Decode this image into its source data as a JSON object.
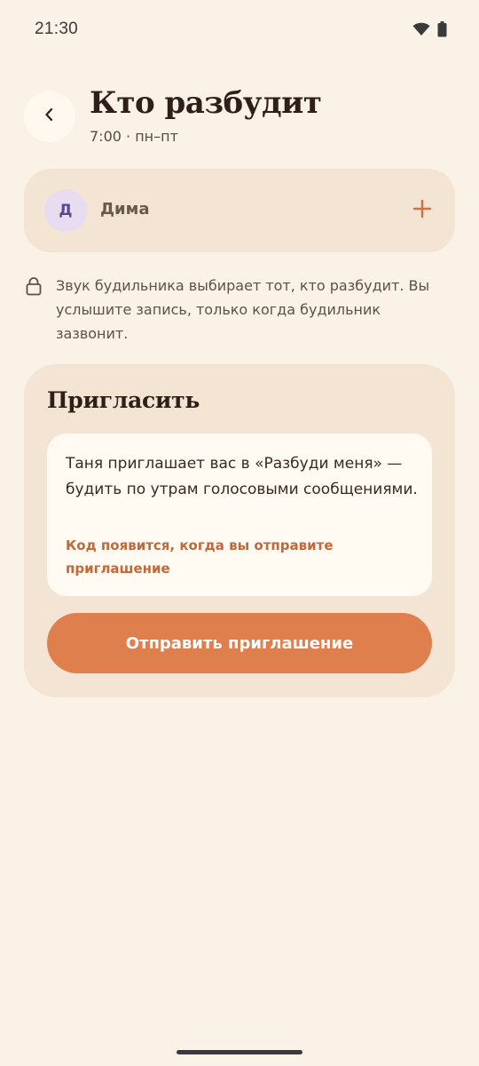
{
  "status_bar": {
    "time": "21:30",
    "icons": [
      "wifi-icon",
      "battery-icon"
    ]
  },
  "header": {
    "back_icon": "chevron-left-icon",
    "title": "Кто разбудит",
    "subtitle": "7:00 · пн–пт"
  },
  "waker": {
    "avatar_initial": "Д",
    "name": "Дима",
    "add_icon": "plus-icon"
  },
  "privacy": {
    "icon": "lock-icon",
    "text": "Звук будильника выбирает тот, кто разбудит. Вы услышите запись, только когда будильник зазвонит."
  },
  "invite": {
    "title": "Пригласить",
    "message": "Таня приглашает вас в «Разбуди меня» — будить по утрам голосовыми сообщениями.",
    "code_note": "Код появится, когда вы отправите приглашение",
    "send_label": "Отправить приглашение"
  },
  "colors": {
    "background": "#FAF1E7",
    "card": "#F3E4D4",
    "accent": "#E07F4E",
    "accent_text": "#C2683A",
    "avatar_bg": "#E8DDF0"
  }
}
